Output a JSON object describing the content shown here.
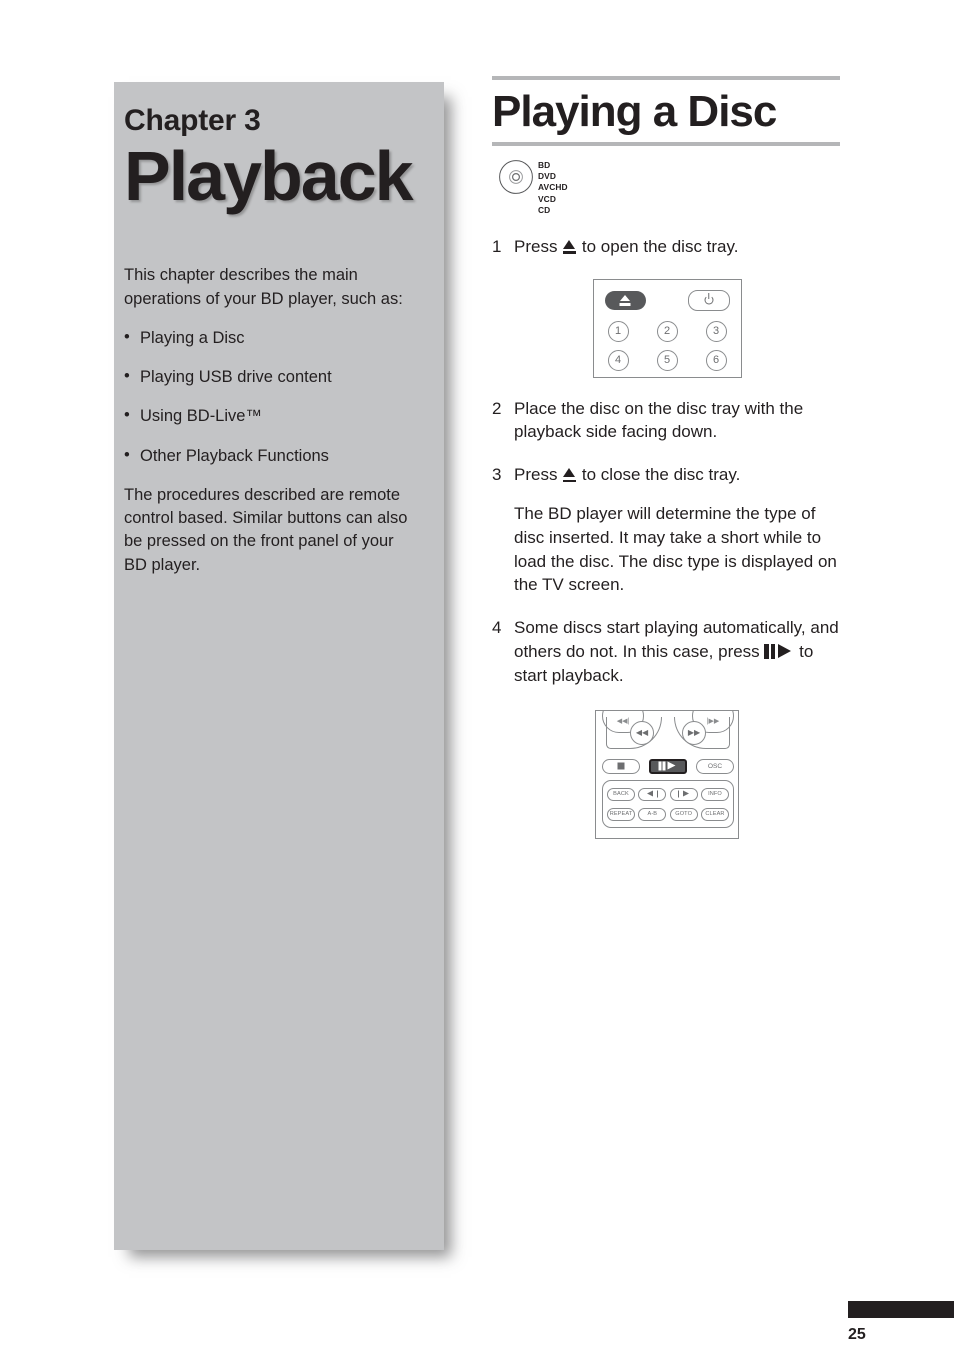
{
  "sidebar": {
    "chapter_label": "Chapter 3",
    "chapter_title": "Playback",
    "intro": "This chapter describes the main operations of your BD player, such as:",
    "bullet_char": "•",
    "items": [
      {
        "label": "Playing a Disc"
      },
      {
        "label": "Playing USB drive content"
      },
      {
        "label": "Using BD-Live™"
      },
      {
        "label": "Other Playback Functions"
      }
    ],
    "outro": "The procedures described are remote control based. Similar buttons can also be pressed on the front panel of your BD player."
  },
  "content": {
    "heading": "Playing a Disc",
    "disc_formats": [
      "BD",
      "DVD",
      "AVCHD",
      "VCD",
      "CD"
    ],
    "steps": [
      {
        "num": "1",
        "parts": [
          {
            "text_before": "Press ",
            "glyph": "eject-icon",
            "text_after": " to open the disc tray."
          }
        ]
      },
      {
        "num": "2",
        "paragraphs": [
          "Place the disc on the disc tray with the playback side facing down."
        ]
      },
      {
        "num": "3",
        "parts": [
          {
            "text_before": "Press ",
            "glyph": "eject-icon",
            "text_after": " to close the disc tray."
          }
        ],
        "paragraphs": [
          "The BD player will determine the type of disc inserted. It may take a short while to load the disc. The disc type is displayed on the TV screen."
        ]
      },
      {
        "num": "4",
        "parts": [
          {
            "text_before": "Some discs start playing automatically, and others do not. In this case, press ",
            "glyph": "play-pause-icon",
            "text_after": " to start playback."
          }
        ]
      }
    ]
  },
  "remote_top": {
    "eject_label": "",
    "power_label": "",
    "numbers": [
      "1",
      "2",
      "3",
      "4",
      "5",
      "6"
    ]
  },
  "remote_bottom": {
    "skip_back_label": "◀◀|",
    "skip_fwd_label": "|▶▶",
    "rewind_label": "◀◀",
    "forward_label": "▶▶",
    "stop_label": "",
    "playpause_label": "",
    "osc_label": "OSC",
    "keys_row1": [
      "BACK",
      "",
      "",
      "INFO"
    ],
    "keys_row2": [
      "REPEAT",
      "A-B",
      "GOTO",
      "CLEAR"
    ]
  },
  "footer": {
    "page_number": "25"
  },
  "colors": {
    "sidebar_bg": "#c3c4c6",
    "text": "#231f20",
    "rule": "#b5b6b8",
    "button_outline": "#8a8c8e",
    "highlight_fill": "#58595b"
  }
}
